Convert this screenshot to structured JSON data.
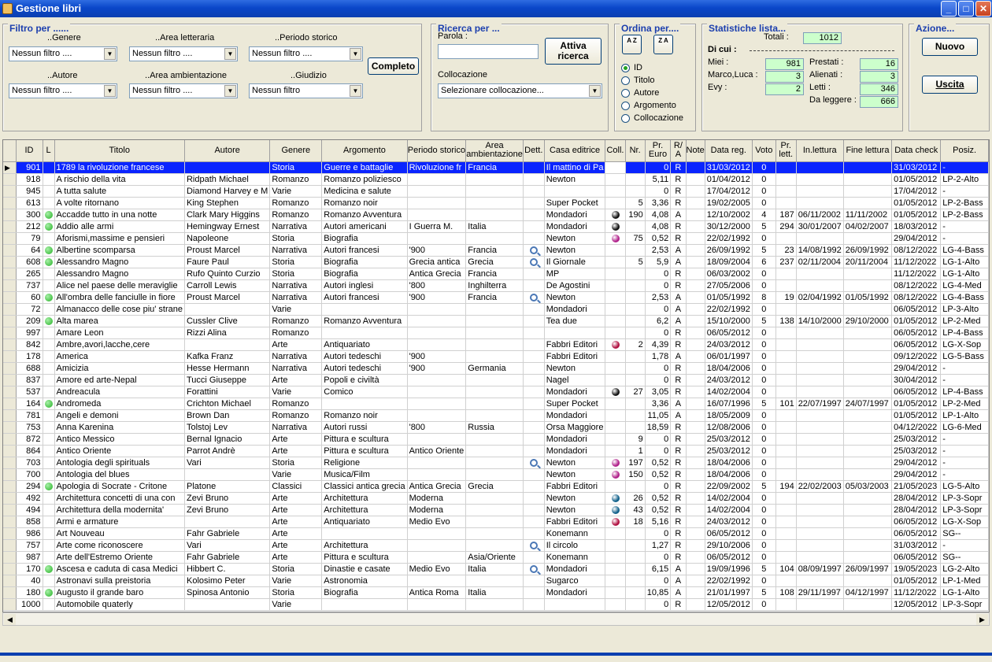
{
  "window": {
    "title": "Gestione libri"
  },
  "filter": {
    "title": "Filtro per ......",
    "genere_label": "..Genere",
    "area_letteraria_label": "..Area letteraria",
    "periodo_label": "..Periodo storico",
    "autore_label": "..Autore",
    "area_amb_label": "..Area ambientazione",
    "giudizio_label": "..Giudizio",
    "genere_value": "Nessun filtro ....",
    "area_letteraria_value": "Nessun filtro ....",
    "periodo_value": "Nessun filtro ....",
    "autore_value": "Nessun filtro ....",
    "area_amb_value": "Nessun filtro ....",
    "giudizio_value": "Nessun filtro",
    "completo": "Completo"
  },
  "search": {
    "title": "Ricerca per ...",
    "parola_label": "Parola :",
    "parola_value": "",
    "activate": "Attiva ricerca",
    "collocazione_label": "Collocazione",
    "collocazione_value": "Selezionare collocazione..."
  },
  "order": {
    "title": "Ordina per....",
    "az": "A Z",
    "za": "Z A",
    "options": [
      "ID",
      "Titolo",
      "Autore",
      "Argomento",
      "Collocazione"
    ],
    "selected": "ID"
  },
  "stats": {
    "title": "Statistiche lista...",
    "totali_label": "Totali :",
    "totali": "1012",
    "dicui": "Di cui :",
    "miei_label": "Miei :",
    "miei": "981",
    "marco_label": "Marco,Luca :",
    "marco": "3",
    "evy_label": "Evy :",
    "evy": "2",
    "prestati_label": "Prestati :",
    "prestati": "16",
    "alienati_label": "Alienati :",
    "alienati": "3",
    "letti_label": "Letti :",
    "letti": "346",
    "daleggere_label": "Da leggere :",
    "daleggere": "666"
  },
  "actions": {
    "title": "Azione...",
    "nuovo": "Nuovo",
    "uscita": "Uscita"
  },
  "colors": {
    "green": "#22b022",
    "black": "#111111",
    "purple": "#b0208a",
    "crimson": "#b01040",
    "teal": "#10608a"
  },
  "columns": [
    "ID",
    "L",
    "Titolo",
    "Autore",
    "Genere",
    "Argomento",
    "Periodo storico",
    "Area ambientazione",
    "Dett.",
    "Casa editrice",
    "Coll.",
    "Nr.",
    "Pr. Euro",
    "R/ A",
    "Note",
    "Data reg.",
    "Voto",
    "Pr. lett.",
    "In.lettura",
    "Fine lettura",
    "Data check",
    "Posiz."
  ],
  "rows": [
    [
      "901",
      "",
      "1789 la rivoluzione francese",
      "",
      "Storia",
      "Guerre e battaglie",
      "Rivoluzione fr",
      "Francia",
      "",
      "Il mattino di Pa",
      "white",
      "",
      "0",
      "R",
      "",
      "31/03/2012",
      "0",
      "",
      "",
      "",
      "31/03/2012",
      "-"
    ],
    [
      "918",
      "",
      "A rischio della vita",
      "Ridpath Michael",
      "Romanzo",
      "Romanzo poliziesco",
      "",
      "",
      "",
      "Newton",
      "",
      "",
      "5,11",
      "R",
      "",
      "01/04/2012",
      "0",
      "",
      "",
      "",
      "01/05/2012",
      "LP-2-Alto"
    ],
    [
      "945",
      "",
      "A tutta salute",
      "Diamond Harvey e M",
      "Varie",
      "Medicina e salute",
      "",
      "",
      "",
      "",
      "",
      "",
      "0",
      "R",
      "",
      "17/04/2012",
      "0",
      "",
      "",
      "",
      "17/04/2012",
      "-"
    ],
    [
      "613",
      "",
      "A volte ritornano",
      "King Stephen",
      "Romanzo",
      "Romanzo noir",
      "",
      "",
      "",
      "Super Pocket",
      "",
      "5",
      "3,36",
      "R",
      "",
      "19/02/2005",
      "0",
      "",
      "",
      "",
      "01/05/2012",
      "LP-2-Bass"
    ],
    [
      "300",
      "green",
      "Accadde tutto in una notte",
      "Clark Mary Higgins",
      "Romanzo",
      "Romanzo Avventura",
      "",
      "",
      "",
      "Mondadori",
      "black",
      "190",
      "4,08",
      "A",
      "",
      "12/10/2002",
      "4",
      "187",
      "06/11/2002",
      "11/11/2002",
      "01/05/2012",
      "LP-2-Bass"
    ],
    [
      "212",
      "green",
      "Addio alle armi",
      "Hemingway Ernest",
      "Narrativa",
      "Autori americani",
      "I Guerra M.",
      "Italia",
      "",
      "Mondadori",
      "black",
      "",
      "4,08",
      "R",
      "",
      "30/12/2000",
      "5",
      "294",
      "30/01/2007",
      "04/02/2007",
      "18/03/2012",
      "-"
    ],
    [
      "79",
      "",
      "Aforismi,massime e pensieri",
      "Napoleone",
      "Storia",
      "Biografia",
      "",
      "",
      "",
      "Newton",
      "purple",
      "75",
      "0,52",
      "R",
      "",
      "22/02/1992",
      "0",
      "",
      "",
      "",
      "29/04/2012",
      "-"
    ],
    [
      "64",
      "green",
      "Albertine scomparsa",
      "Proust Marcel",
      "Narrativa",
      "Autori francesi",
      "'900",
      "Francia",
      "mag",
      "Newton",
      "",
      "",
      "2,53",
      "A",
      "",
      "26/09/1992",
      "5",
      "23",
      "14/08/1992",
      "26/09/1992",
      "08/12/2022",
      "LG-4-Bass"
    ],
    [
      "608",
      "green",
      "Alessandro Magno",
      "Faure Paul",
      "Storia",
      "Biografia",
      "Grecia antica",
      "Grecia",
      "mag",
      "Il Giornale",
      "",
      "5",
      "5,9",
      "A",
      "",
      "18/09/2004",
      "6",
      "237",
      "02/11/2004",
      "20/11/2004",
      "11/12/2022",
      "LG-1-Alto"
    ],
    [
      "265",
      "",
      "Alessandro Magno",
      "Rufo Quinto Curzio",
      "Storia",
      "Biografia",
      "Antica Grecia",
      "Francia",
      "",
      "MP",
      "",
      "",
      "0",
      "R",
      "",
      "06/03/2002",
      "0",
      "",
      "",
      "",
      "11/12/2022",
      "LG-1-Alto"
    ],
    [
      "737",
      "",
      "Alice nel paese delle meraviglie",
      "Carroll Lewis",
      "Narrativa",
      "Autori inglesi",
      "'800",
      "Inghilterra",
      "",
      "De Agostini",
      "",
      "",
      "0",
      "R",
      "",
      "27/05/2006",
      "0",
      "",
      "",
      "",
      "08/12/2022",
      "LG-4-Med"
    ],
    [
      "60",
      "green",
      "All'ombra delle fanciulle in fiore",
      "Proust Marcel",
      "Narrativa",
      "Autori francesi",
      "'900",
      "Francia",
      "mag",
      "Newton",
      "",
      "",
      "2,53",
      "A",
      "",
      "01/05/1992",
      "8",
      "19",
      "02/04/1992",
      "01/05/1992",
      "08/12/2022",
      "LG-4-Bass"
    ],
    [
      "72",
      "",
      "Almanacco delle cose piu' strane",
      "",
      "Varie",
      "",
      "",
      "",
      "",
      "Mondadori",
      "",
      "",
      "0",
      "A",
      "",
      "22/02/1992",
      "0",
      "",
      "",
      "",
      "06/05/2012",
      "LP-3-Alto"
    ],
    [
      "209",
      "green",
      "Alta marea",
      "Cussler Clive",
      "Romanzo",
      "Romanzo Avventura",
      "",
      "",
      "",
      "Tea due",
      "",
      "",
      "6,2",
      "A",
      "",
      "15/10/2000",
      "5",
      "138",
      "14/10/2000",
      "29/10/2000",
      "01/05/2012",
      "LP-2-Med"
    ],
    [
      "997",
      "",
      "Amare Leon",
      "Rizzi Alina",
      "Romanzo",
      "",
      "",
      "",
      "",
      "",
      "",
      "",
      "0",
      "R",
      "",
      "06/05/2012",
      "0",
      "",
      "",
      "",
      "06/05/2012",
      "LP-4-Bass"
    ],
    [
      "842",
      "",
      "Ambre,avori,lacche,cere",
      "",
      "Arte",
      "Antiquariato",
      "",
      "",
      "",
      "Fabbri Editori",
      "crimson",
      "2",
      "4,39",
      "R",
      "",
      "24/03/2012",
      "0",
      "",
      "",
      "",
      "06/05/2012",
      "LG-X-Sop"
    ],
    [
      "178",
      "",
      "America",
      "Kafka Franz",
      "Narrativa",
      "Autori tedeschi",
      "'900",
      "",
      "",
      "Fabbri Editori",
      "",
      "",
      "1,78",
      "A",
      "",
      "06/01/1997",
      "0",
      "",
      "",
      "",
      "09/12/2022",
      "LG-5-Bass"
    ],
    [
      "688",
      "",
      "Amicizia",
      "Hesse Hermann",
      "Narrativa",
      "Autori tedeschi",
      "'900",
      "Germania",
      "",
      "Newton",
      "",
      "",
      "0",
      "R",
      "",
      "18/04/2006",
      "0",
      "",
      "",
      "",
      "29/04/2012",
      "-"
    ],
    [
      "837",
      "",
      "Amore ed arte-Nepal",
      "Tucci  Giuseppe",
      "Arte",
      "Popoli e civiltà",
      "",
      "",
      "",
      "Nagel",
      "",
      "",
      "0",
      "R",
      "",
      "24/03/2012",
      "0",
      "",
      "",
      "",
      "30/04/2012",
      "-"
    ],
    [
      "537",
      "",
      "Andreacula",
      "Forattini",
      "Varie",
      "Comico",
      "",
      "",
      "",
      "Mondadori",
      "black",
      "27",
      "3,05",
      "R",
      "",
      "14/02/2004",
      "0",
      "",
      "",
      "",
      "06/05/2012",
      "LP-4-Bass"
    ],
    [
      "164",
      "green",
      "Andromeda",
      "Crichton Michael",
      "Romanzo",
      "",
      "",
      "",
      "",
      "Super Pocket",
      "",
      "",
      "3,36",
      "A",
      "",
      "16/07/1996",
      "5",
      "101",
      "22/07/1997",
      "24/07/1997",
      "01/05/2012",
      "LP-2-Med"
    ],
    [
      "781",
      "",
      "Angeli e demoni",
      "Brown Dan",
      "Romanzo",
      "Romanzo noir",
      "",
      "",
      "",
      "Mondadori",
      "",
      "",
      "11,05",
      "A",
      "",
      "18/05/2009",
      "0",
      "",
      "",
      "",
      "01/05/2012",
      "LP-1-Alto"
    ],
    [
      "753",
      "",
      "Anna Karenina",
      "Tolstoj Lev",
      "Narrativa",
      "Autori russi",
      "'800",
      "Russia",
      "",
      "Orsa Maggiore",
      "",
      "",
      "18,59",
      "R",
      "",
      "12/08/2006",
      "0",
      "",
      "",
      "",
      "04/12/2022",
      "LG-6-Med"
    ],
    [
      "872",
      "",
      "Antico Messico",
      "Bernal Ignacio",
      "Arte",
      "Pittura e scultura",
      "",
      "",
      "",
      "Mondadori",
      "",
      "9",
      "0",
      "R",
      "",
      "25/03/2012",
      "0",
      "",
      "",
      "",
      "25/03/2012",
      "-"
    ],
    [
      "864",
      "",
      "Antico Oriente",
      "Parrot Andrè",
      "Arte",
      "Pittura e scultura",
      "Antico Oriente",
      "",
      "",
      "Mondadori",
      "",
      "1",
      "0",
      "R",
      "",
      "25/03/2012",
      "0",
      "",
      "",
      "",
      "25/03/2012",
      "-"
    ],
    [
      "703",
      "",
      "Antologia degli spirituals",
      "Vari",
      "Storia",
      "Religione",
      "",
      "",
      "mag",
      "Newton",
      "purple",
      "197",
      "0,52",
      "R",
      "",
      "18/04/2006",
      "0",
      "",
      "",
      "",
      "29/04/2012",
      "-"
    ],
    [
      "700",
      "",
      "Antologia del blues",
      "",
      "Varie",
      "Musica/Film",
      "",
      "",
      "",
      "Newton",
      "purple",
      "150",
      "0,52",
      "R",
      "",
      "18/04/2006",
      "0",
      "",
      "",
      "",
      "29/04/2012",
      "-"
    ],
    [
      "294",
      "green",
      "Apologia di Socrate - Critone",
      "Platone",
      "Classici",
      "Classici antica grecia",
      "Antica Grecia",
      "Grecia",
      "",
      "Fabbri Editori",
      "",
      "",
      "0",
      "R",
      "",
      "22/09/2002",
      "5",
      "194",
      "22/02/2003",
      "05/03/2003",
      "21/05/2023",
      "LG-5-Alto"
    ],
    [
      "492",
      "",
      "Architettura concetti di una con",
      "Zevi Bruno",
      "Arte",
      "Architettura",
      "Moderna",
      "",
      "",
      "Newton",
      "teal",
      "26",
      "0,52",
      "R",
      "",
      "14/02/2004",
      "0",
      "",
      "",
      "",
      "28/04/2012",
      "LP-3-Sopr"
    ],
    [
      "494",
      "",
      "Architettura della modernita'",
      "Zevi Bruno",
      "Arte",
      "Architettura",
      "Moderna",
      "",
      "",
      "Newton",
      "teal",
      "43",
      "0,52",
      "R",
      "",
      "14/02/2004",
      "0",
      "",
      "",
      "",
      "28/04/2012",
      "LP-3-Sopr"
    ],
    [
      "858",
      "",
      "Armi e armature",
      "",
      "Arte",
      "Antiquariato",
      "Medio Evo",
      "",
      "",
      "Fabbri Editori",
      "crimson",
      "18",
      "5,16",
      "R",
      "",
      "24/03/2012",
      "0",
      "",
      "",
      "",
      "06/05/2012",
      "LG-X-Sop"
    ],
    [
      "986",
      "",
      "Art Nouveau",
      "Fahr Gabriele",
      "Arte",
      "",
      "",
      "",
      "",
      "Konemann",
      "",
      "",
      "0",
      "R",
      "",
      "06/05/2012",
      "0",
      "",
      "",
      "",
      "06/05/2012",
      "SG--"
    ],
    [
      "757",
      "",
      "Arte come riconoscere",
      "Vari",
      "Arte",
      "Architettura",
      "",
      "",
      "mag",
      "Il circolo",
      "",
      "",
      "1,27",
      "R",
      "",
      "29/10/2006",
      "0",
      "",
      "",
      "",
      "31/03/2012",
      "-"
    ],
    [
      "987",
      "",
      "Arte dell'Estremo Oriente",
      "Fahr Gabriele",
      "Arte",
      "Pittura e scultura",
      "",
      "Asia/Oriente",
      "",
      "Konemann",
      "",
      "",
      "0",
      "R",
      "",
      "06/05/2012",
      "0",
      "",
      "",
      "",
      "06/05/2012",
      "SG--"
    ],
    [
      "170",
      "green",
      "Ascesa e caduta di casa Medici",
      "Hibbert C.",
      "Storia",
      "Dinastie e casate",
      "Medio Evo",
      "Italia",
      "mag",
      "Mondadori",
      "",
      "",
      "6,15",
      "A",
      "",
      "19/09/1996",
      "5",
      "104",
      "08/09/1997",
      "26/09/1997",
      "19/05/2023",
      "LG-2-Alto"
    ],
    [
      "40",
      "",
      "Astronavi sulla preistoria",
      "Kolosimo Peter",
      "Varie",
      "Astronomia",
      "",
      "",
      "",
      "Sugarco",
      "",
      "",
      "0",
      "A",
      "",
      "22/02/1992",
      "0",
      "",
      "",
      "",
      "01/05/2012",
      "LP-1-Med"
    ],
    [
      "180",
      "green",
      "Augusto il grande baro",
      "Spinosa Antonio",
      "Storia",
      "Biografia",
      "Antica Roma",
      "Italia",
      "",
      "Mondadori",
      "",
      "",
      "10,85",
      "A",
      "",
      "21/01/1997",
      "5",
      "108",
      "29/11/1997",
      "04/12/1997",
      "11/12/2022",
      "LG-1-Alto"
    ],
    [
      "1000",
      "",
      "Automobile quaterly",
      "",
      "Varie",
      "",
      "",
      "",
      "",
      "",
      "",
      "",
      "0",
      "R",
      "",
      "12/05/2012",
      "0",
      "",
      "",
      "",
      "12/05/2012",
      "LP-3-Sopr"
    ]
  ]
}
